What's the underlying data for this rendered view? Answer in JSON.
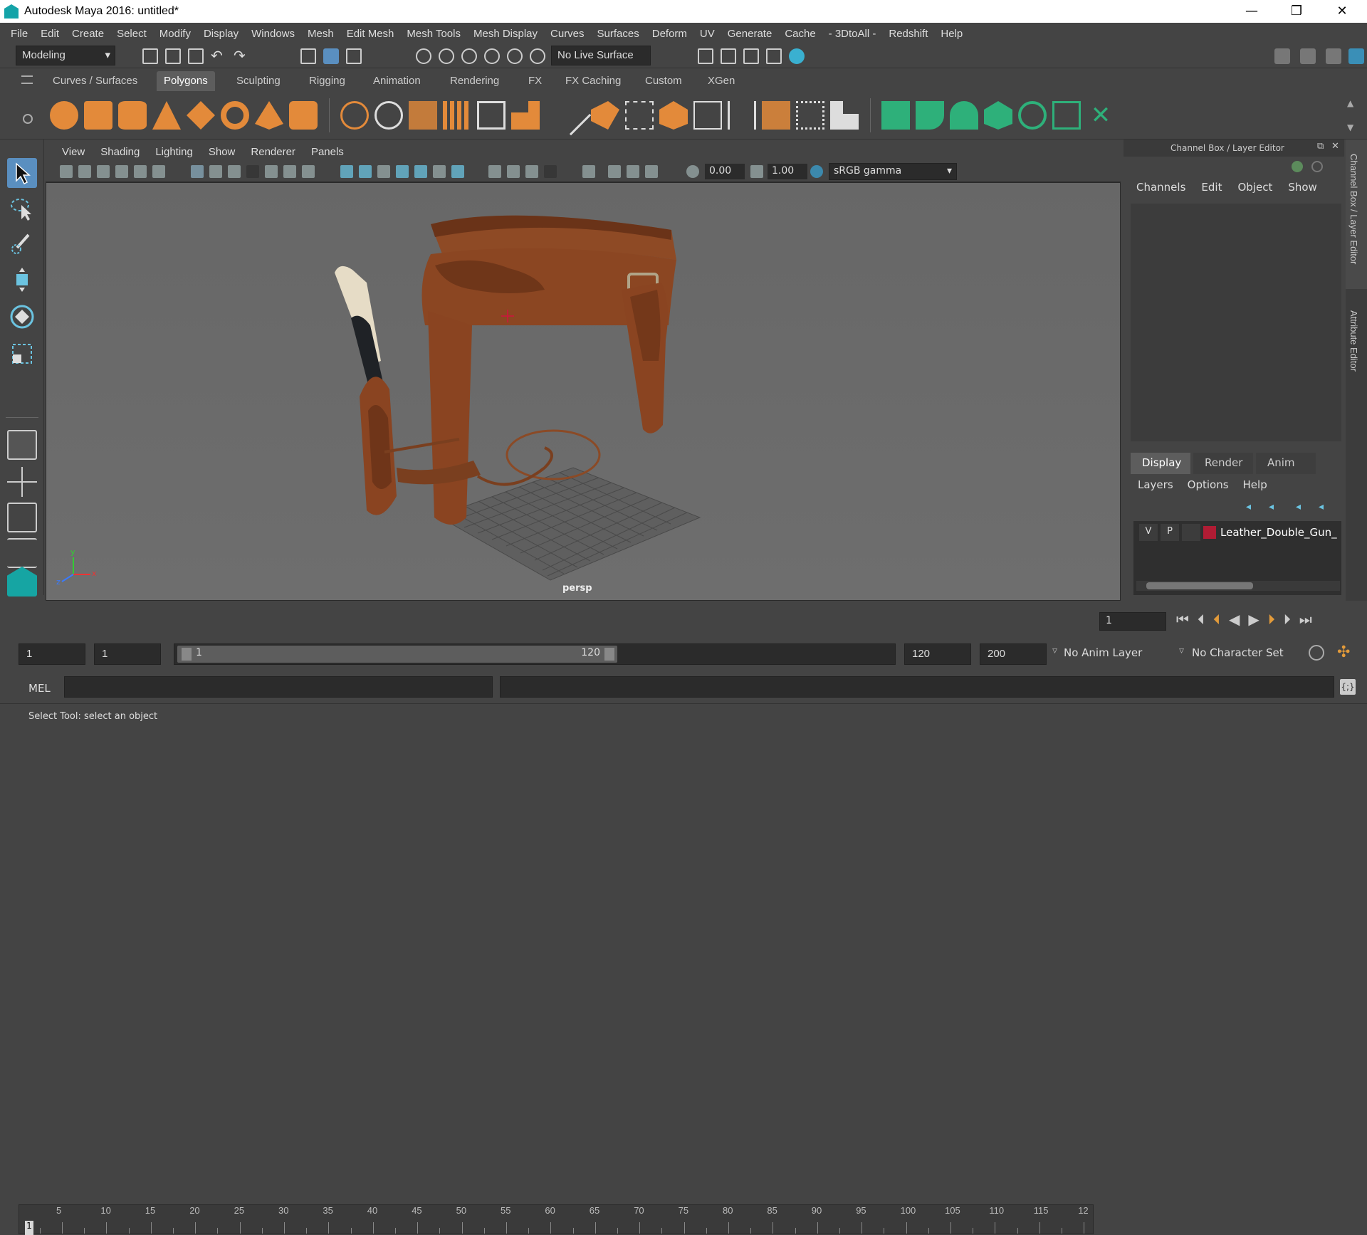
{
  "window": {
    "title": "Autodesk Maya 2016: untitled*",
    "minimize": "—",
    "restore": "❐",
    "close": "✕"
  },
  "menubar": [
    "File",
    "Edit",
    "Create",
    "Select",
    "Modify",
    "Display",
    "Windows",
    "Mesh",
    "Edit Mesh",
    "Mesh Tools",
    "Mesh Display",
    "Curves",
    "Surfaces",
    "Deform",
    "UV",
    "Generate",
    "Cache",
    "- 3DtoAll -",
    "Redshift",
    "Help"
  ],
  "statusline": {
    "mode": "Modeling",
    "live_surface": "No Live Surface"
  },
  "shelf_tabs": [
    "Curves / Surfaces",
    "Polygons",
    "Sculpting",
    "Rigging",
    "Animation",
    "Rendering",
    "FX",
    "FX Caching",
    "Custom",
    "XGen"
  ],
  "shelf_active": "Polygons",
  "viewport": {
    "menu": [
      "View",
      "Shading",
      "Lighting",
      "Show",
      "Renderer",
      "Panels"
    ],
    "exposure": "0.00",
    "gamma": "1.00",
    "color_space": "sRGB gamma",
    "camera_label": "persp",
    "axis_x": "x",
    "axis_y": "y",
    "axis_z": "z"
  },
  "channelbox": {
    "title": "Channel Box / Layer Editor",
    "menu": [
      "Channels",
      "Edit",
      "Object",
      "Show"
    ]
  },
  "layer_editor": {
    "tabs": [
      "Display",
      "Render",
      "Anim"
    ],
    "active_tab": "Display",
    "menu": [
      "Layers",
      "Options",
      "Help"
    ],
    "layer": {
      "v": "V",
      "p": "P",
      "name": "Leather_Double_Gun_",
      "color": "#b01c34"
    }
  },
  "side_tabs": [
    "Channel Box / Layer Editor",
    "Attribute Editor"
  ],
  "timeline": {
    "ticks": [
      "5",
      "10",
      "15",
      "20",
      "25",
      "30",
      "35",
      "40",
      "45",
      "50",
      "55",
      "60",
      "65",
      "70",
      "75",
      "80",
      "85",
      "90",
      "95",
      "100",
      "105",
      "110",
      "115",
      "12"
    ],
    "current_marker": "1",
    "current_frame": "1"
  },
  "range": {
    "start": "1",
    "playback_start": "1",
    "slider_start": "1",
    "slider_end": "120",
    "playback_end": "120",
    "end": "200",
    "anim_layer": "No Anim Layer",
    "character_set": "No Character Set"
  },
  "command": {
    "label": "MEL"
  },
  "help": {
    "text": "Select Tool: select an object"
  }
}
